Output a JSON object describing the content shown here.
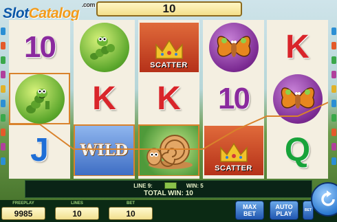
{
  "header": {
    "bet_display": "10"
  },
  "logo": {
    "part1": "Slot",
    "part2": "Catalog",
    "suffix": ".com"
  },
  "reels": [
    [
      "10",
      "caterpillar",
      "J"
    ],
    [
      "caterpillar",
      "K",
      "WILD"
    ],
    [
      "SCATTER",
      "K",
      "snail"
    ],
    [
      "butterfly",
      "10",
      "SCATTER"
    ],
    [
      "K",
      "butterfly",
      "Q"
    ]
  ],
  "symbol_labels": {
    "scatter": "SCATTER",
    "wild": "WILD"
  },
  "info": {
    "line_label": "LINE 9:",
    "win_label": "WIN: 5",
    "total_win": "TOTAL WIN: 10"
  },
  "panel": {
    "freeplay_label": "FREEPLAY",
    "freeplay_value": "9985",
    "lines_label": "LINES",
    "lines_value": "10",
    "bet_label": "BET",
    "bet_value": "10"
  },
  "buttons": {
    "max_bet": [
      "MAX",
      "BET"
    ],
    "auto_play": [
      "AUTO",
      "PLAY"
    ],
    "bet_small": "BET"
  },
  "colors": {
    "winline": "#d9822b",
    "ten": "#8a2a9e",
    "k": "#d9252a",
    "j": "#1e6ed6",
    "q": "#18a33a"
  }
}
